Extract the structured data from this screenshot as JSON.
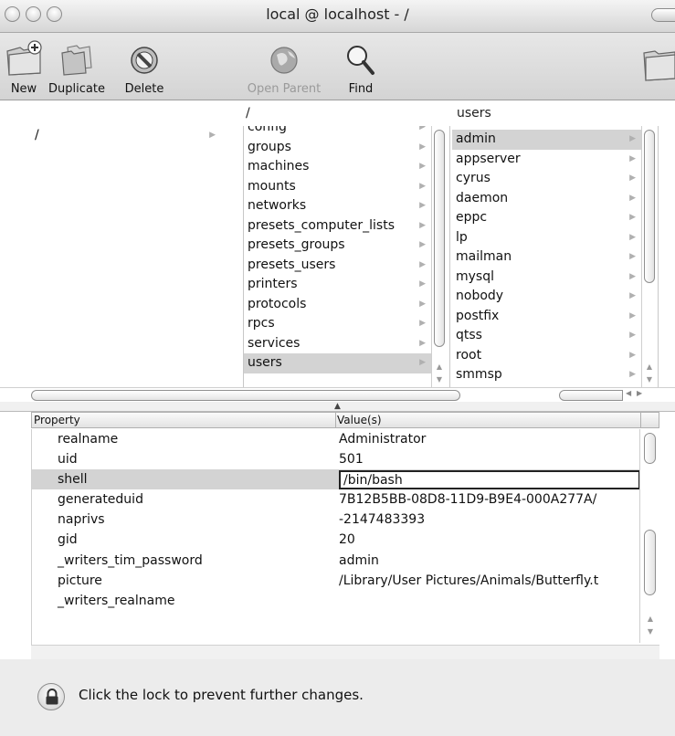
{
  "window": {
    "title": "local @ localhost - /"
  },
  "toolbar": {
    "new_label": "New",
    "duplicate_label": "Duplicate",
    "delete_label": "Delete",
    "open_parent_label": "Open Parent",
    "find_label": "Find"
  },
  "browser": {
    "col1": {
      "header": "",
      "items": [
        {
          "label": "/",
          "selected": false
        }
      ]
    },
    "col2": {
      "header": "/",
      "items": [
        {
          "label": "config",
          "selected": false
        },
        {
          "label": "groups",
          "selected": false
        },
        {
          "label": "machines",
          "selected": false
        },
        {
          "label": "mounts",
          "selected": false
        },
        {
          "label": "networks",
          "selected": false
        },
        {
          "label": "presets_computer_lists",
          "selected": false
        },
        {
          "label": "presets_groups",
          "selected": false
        },
        {
          "label": "presets_users",
          "selected": false
        },
        {
          "label": "printers",
          "selected": false
        },
        {
          "label": "protocols",
          "selected": false
        },
        {
          "label": "rpcs",
          "selected": false
        },
        {
          "label": "services",
          "selected": false
        },
        {
          "label": "users",
          "selected": true
        }
      ]
    },
    "col3": {
      "header": "users",
      "items": [
        {
          "label": "admin",
          "selected": true
        },
        {
          "label": "appserver",
          "selected": false
        },
        {
          "label": "cyrus",
          "selected": false
        },
        {
          "label": "daemon",
          "selected": false
        },
        {
          "label": "eppc",
          "selected": false
        },
        {
          "label": "lp",
          "selected": false
        },
        {
          "label": "mailman",
          "selected": false
        },
        {
          "label": "mysql",
          "selected": false
        },
        {
          "label": "nobody",
          "selected": false
        },
        {
          "label": "postfix",
          "selected": false
        },
        {
          "label": "qtss",
          "selected": false
        },
        {
          "label": "root",
          "selected": false
        },
        {
          "label": "smmsp",
          "selected": false
        }
      ]
    }
  },
  "properties": {
    "headers": {
      "property": "Property",
      "values": "Value(s)"
    },
    "rows": [
      {
        "key": "realname",
        "value": "Administrator",
        "selected": false
      },
      {
        "key": "uid",
        "value": "501",
        "selected": false
      },
      {
        "key": "shell",
        "value": "/bin/bash",
        "selected": true
      },
      {
        "key": "generateduid",
        "value": "7B12B5BB-08D8-11D9-B9E4-000A277A/",
        "selected": false
      },
      {
        "key": "naprivs",
        "value": "-2147483393",
        "selected": false
      },
      {
        "key": "gid",
        "value": "20",
        "selected": false
      },
      {
        "key": "_writers_tim_password",
        "value": "admin",
        "selected": false
      },
      {
        "key": "picture",
        "value": "/Library/User Pictures/Animals/Butterfly.t",
        "selected": false
      },
      {
        "key": "_writers_realname",
        "value": "",
        "selected": false
      }
    ]
  },
  "status": {
    "lock_message": "Click the lock to prevent further changes."
  },
  "icons": {
    "new": "new-folder-icon",
    "duplicate": "duplicate-icon",
    "delete": "delete-icon",
    "open_parent": "globe-icon",
    "find": "magnifier-icon",
    "lock": "lock-icon"
  }
}
